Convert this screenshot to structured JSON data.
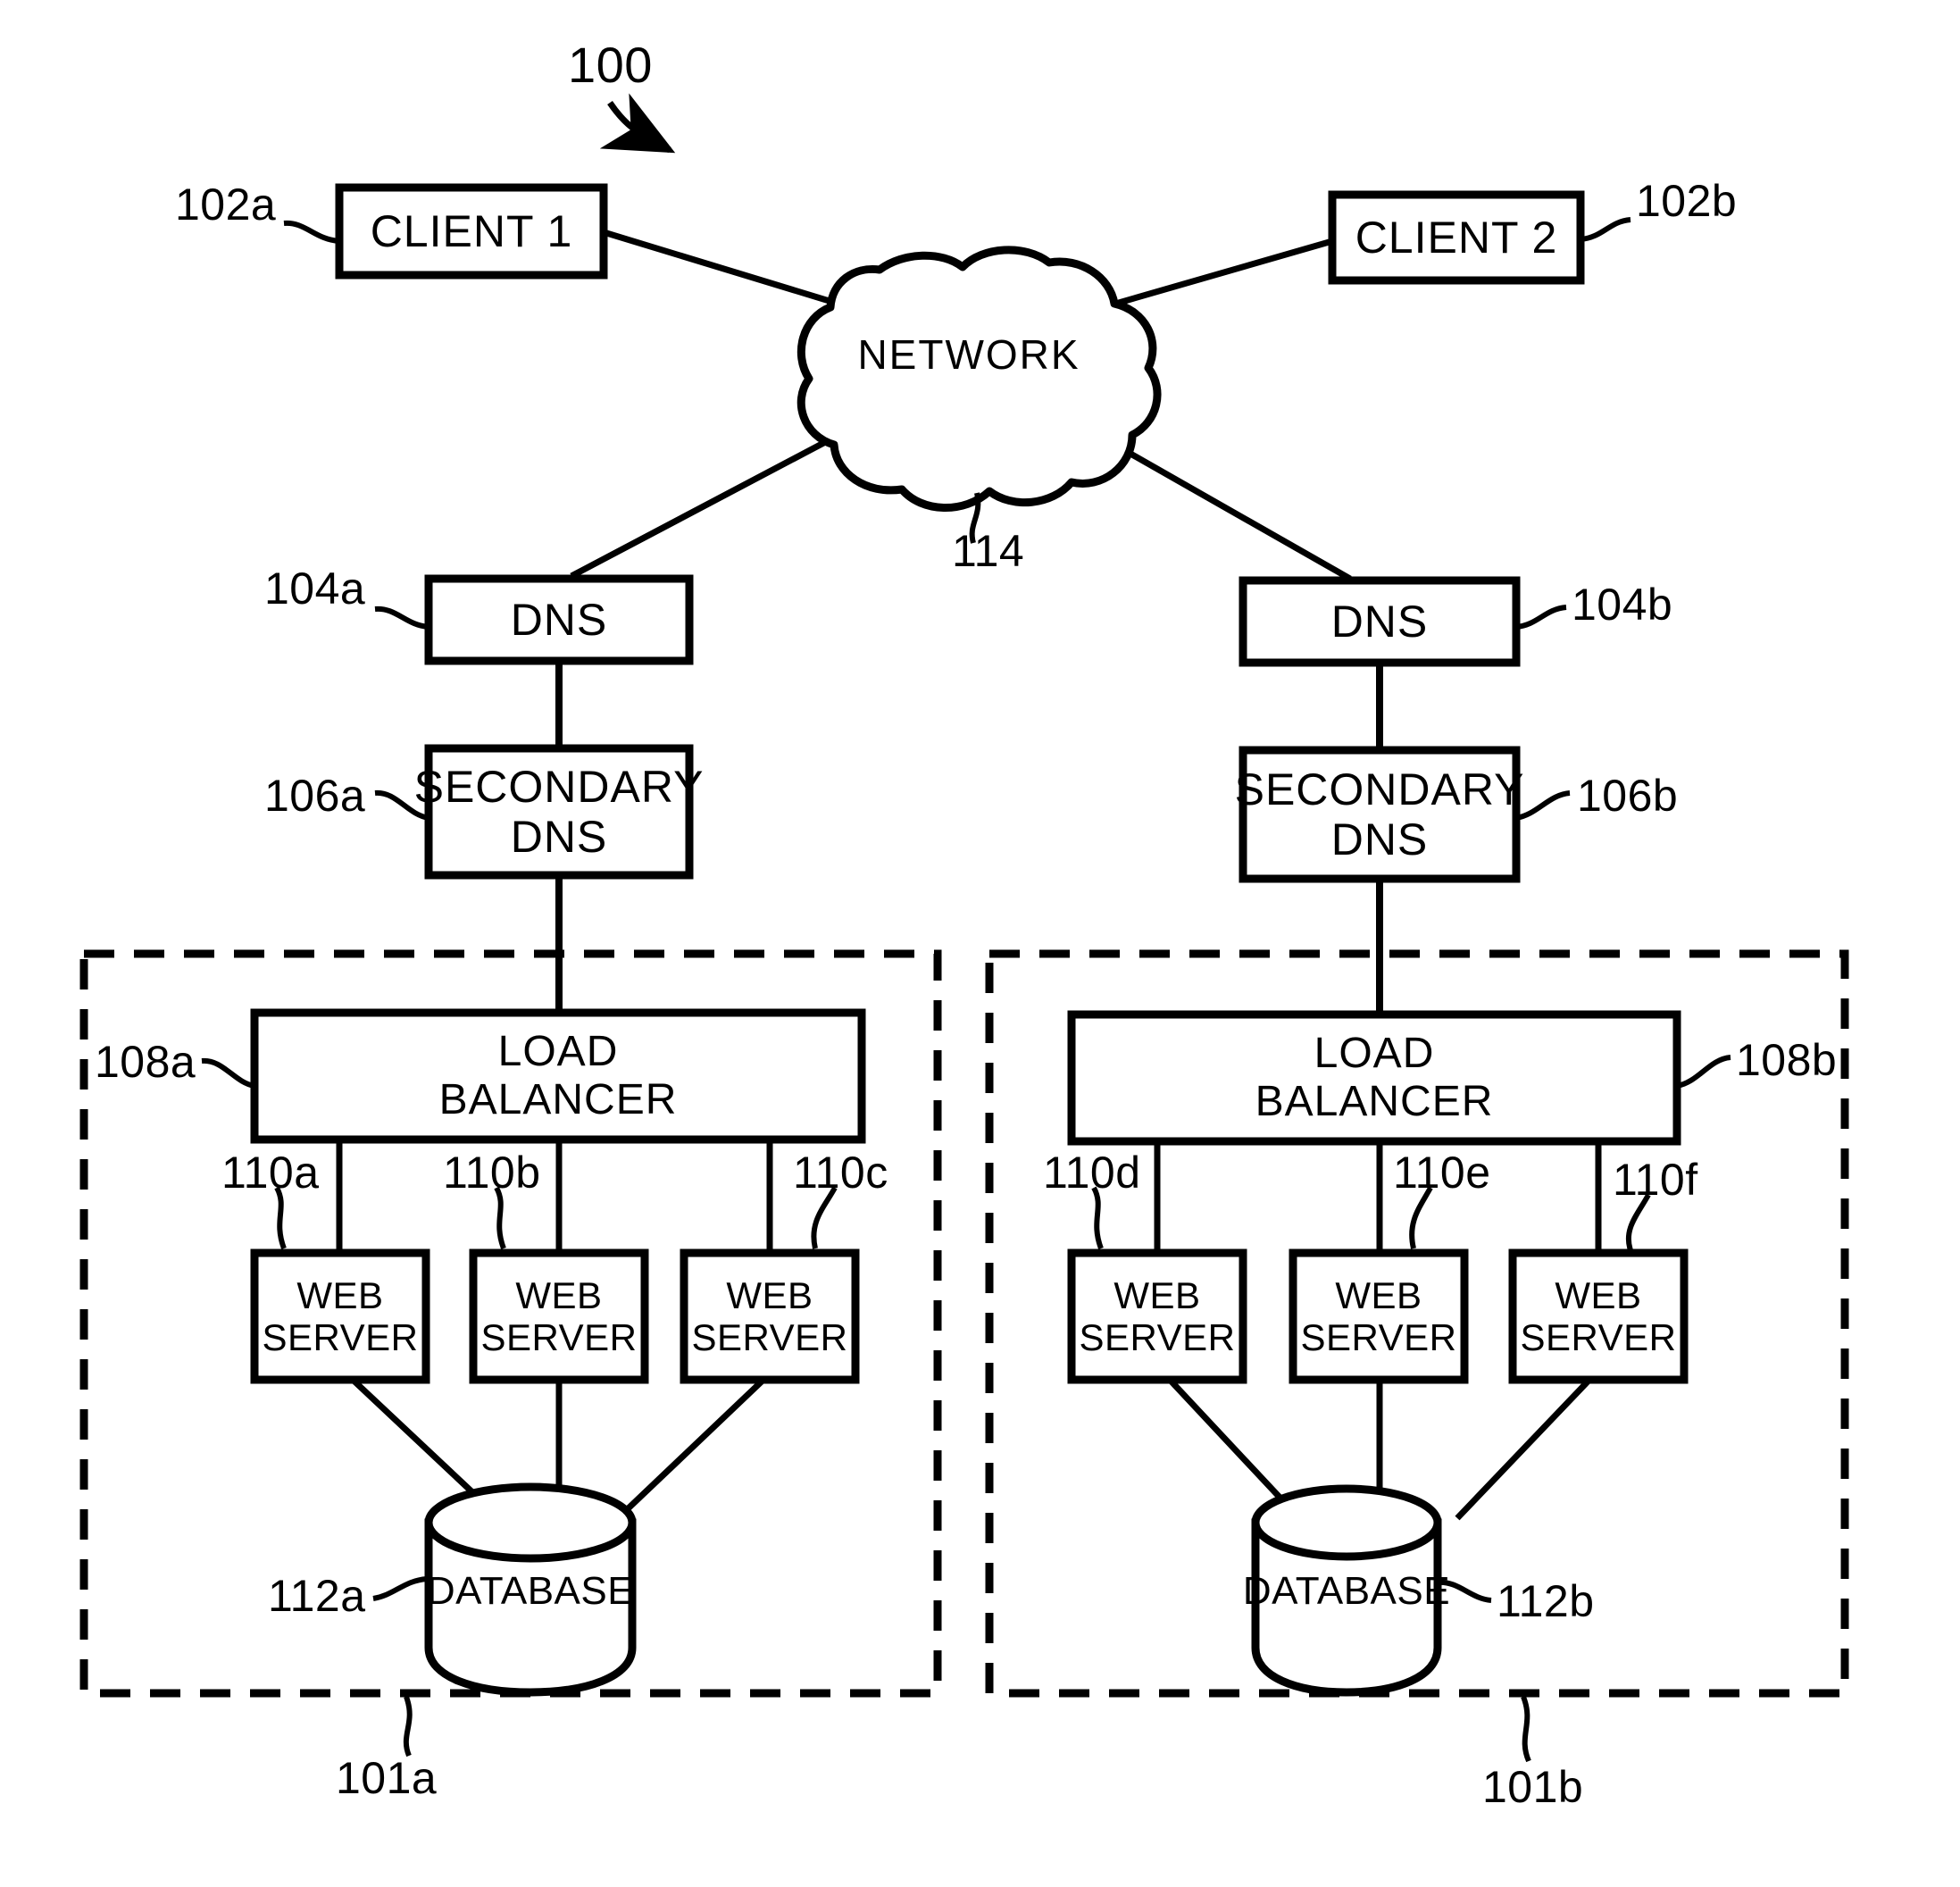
{
  "figure": {
    "reference_numeral": "100",
    "title": "Network system architecture diagram"
  },
  "nodes": {
    "client1": {
      "label": "CLIENT 1",
      "ref": "102a"
    },
    "client2": {
      "label": "CLIENT 2",
      "ref": "102b"
    },
    "network": {
      "label": "NETWORK",
      "ref": "114"
    },
    "dns_a": {
      "label": "DNS",
      "ref": "104a"
    },
    "dns_b": {
      "label": "DNS",
      "ref": "104b"
    },
    "secondary_dns_a": {
      "label": "SECONDARY\nDNS",
      "ref": "106a"
    },
    "secondary_dns_b": {
      "label": "SECONDARY\nDNS",
      "ref": "106b"
    },
    "load_balancer_a": {
      "label": "LOAD\nBALANCER",
      "ref": "108a"
    },
    "load_balancer_b": {
      "label": "LOAD\nBALANCER",
      "ref": "108b"
    },
    "web_server_a1": {
      "label": "WEB\nSERVER",
      "ref": "110a"
    },
    "web_server_a2": {
      "label": "WEB\nSERVER",
      "ref": "110b"
    },
    "web_server_a3": {
      "label": "WEB\nSERVER",
      "ref": "110c"
    },
    "web_server_b1": {
      "label": "WEB\nSERVER",
      "ref": "110d"
    },
    "web_server_b2": {
      "label": "WEB\nSERVER",
      "ref": "110e"
    },
    "web_server_b3": {
      "label": "WEB\nSERVER",
      "ref": "110f"
    },
    "database_a": {
      "label": "DATABASE",
      "ref": "112a"
    },
    "database_b": {
      "label": "DATABASE",
      "ref": "112b"
    },
    "site_a": {
      "ref": "101a"
    },
    "site_b": {
      "ref": "101b"
    }
  },
  "colors": {
    "stroke": "#000000",
    "background": "#ffffff"
  }
}
